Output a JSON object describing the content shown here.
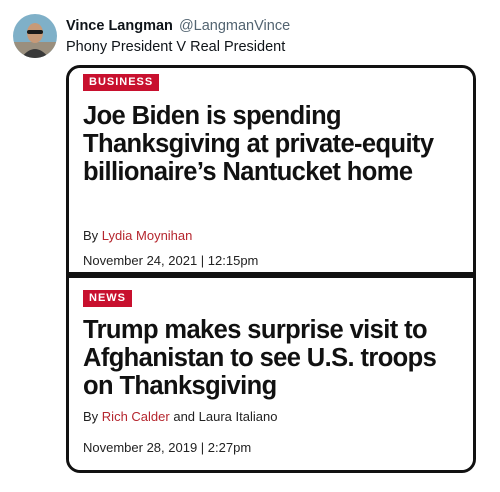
{
  "tweet": {
    "display_name": "Vince Langman",
    "handle": "@LangmanVince",
    "text": "Phony President V Real President"
  },
  "colors": {
    "tag_background": "#c8102e",
    "author_link": "#b5262e"
  },
  "articles": [
    {
      "tag": "BUSINESS",
      "headline": "Joe Biden is spending Thanksgiving at private-equity billionaire’s Nantucket home",
      "by": "By",
      "author": "Lydia Moynihan",
      "date": "November 24, 2021 | 12:15pm"
    },
    {
      "tag": "NEWS",
      "headline": "Trump makes surprise visit to Afghanistan to see U.S. troops on Thanksgiving",
      "by": "By",
      "author": "Rich Calder",
      "coauthor_joiner": "and Laura Italiano",
      "date": "November 28, 2019 | 2:27pm"
    }
  ]
}
